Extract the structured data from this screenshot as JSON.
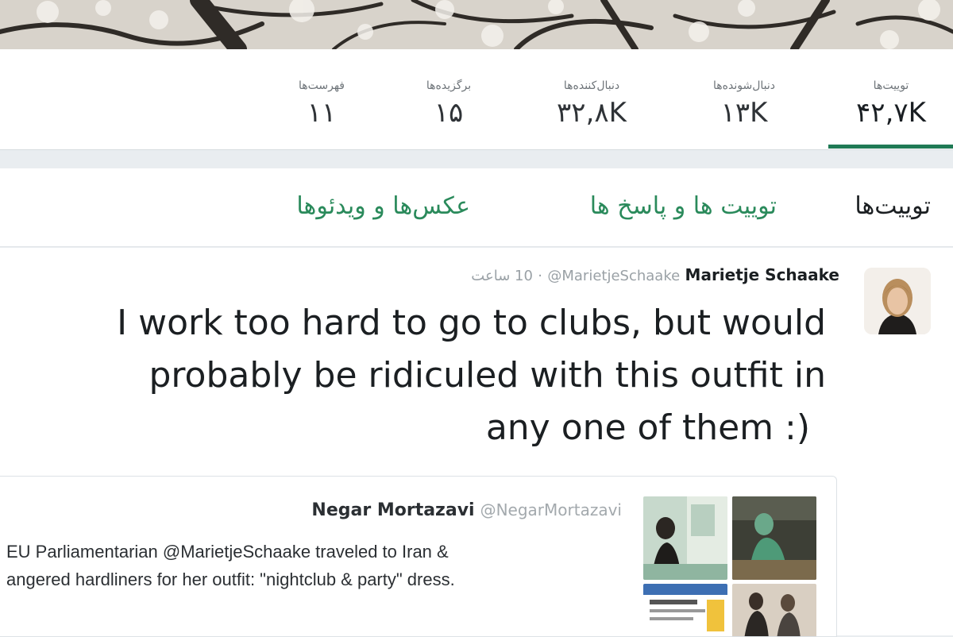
{
  "stats": [
    {
      "label": "توییت‌ها",
      "value": "۴۲,۷K",
      "active": true
    },
    {
      "label": "دنبال‌شونده‌ها",
      "value": "۱۳K"
    },
    {
      "label": "دنبال‌کننده‌ها",
      "value": "۳۲,۸K"
    },
    {
      "label": "برگزیده‌ها",
      "value": "۱۵"
    },
    {
      "label": "فهرست‌ها",
      "value": "۱۱"
    }
  ],
  "tabs": [
    {
      "label": "توییت‌ها",
      "selected": true
    },
    {
      "label": "توییت ها و پاسخ ها"
    },
    {
      "label": "عکس‌ها و ویدئوها"
    }
  ],
  "tweet": {
    "display_name": "Marietje Schaake",
    "handle": "@MarietjeSchaake",
    "separator": "·",
    "time": "10 ساعت",
    "text_lines": [
      "I work too hard to go to clubs, but would",
      "probably be ridiculed with this outfit in",
      "any one of them :)"
    ],
    "quote": {
      "display_name": "Negar Mortazavi",
      "handle": "@NegarMortazavi",
      "text_lines": [
        "EU Parliamentarian @MarietjeSchaake traveled to Iran &",
        "angered hardliners for her outfit: \"nightclub & party\" dress."
      ]
    }
  },
  "colors": {
    "accent": "#1f7a55",
    "tab_green": "#2a8a5b",
    "text_dark": "#1b1f22",
    "text_muted": "#9aa1a6"
  }
}
